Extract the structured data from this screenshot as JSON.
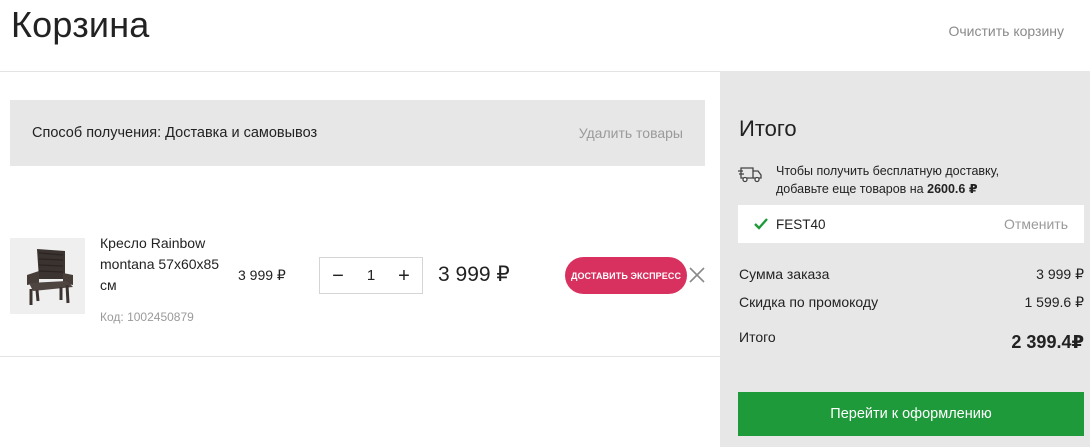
{
  "header": {
    "title": "Корзина",
    "clear_cart_label": "Очистить корзину"
  },
  "delivery": {
    "label": "Способ получения: Доставка и самовывоз",
    "remove_label": "Удалить товары"
  },
  "cart": {
    "items": [
      {
        "name": "Кресло Rainbow montana 57x60x85 см",
        "code": "Код: 1002450879",
        "unit_price": "3 999 ₽",
        "quantity": "1",
        "line_total": "3 999 ₽",
        "express_label": "ДОСТАВИТЬ ЭКСПРЕСС",
        "decrement_label": "−",
        "increment_label": "+"
      }
    ]
  },
  "summary": {
    "title": "Итого",
    "free_delivery_line1": "Чтобы получить бесплатную доставку,",
    "free_delivery_line2": "добавьте еще товаров на ",
    "free_delivery_amount": "2600.6 ₽",
    "promo_code": "FEST40",
    "promo_cancel": "Отменить",
    "order_sum_label": "Сумма заказа",
    "order_sum_value": "3 999 ₽",
    "discount_label": "Скидка по промокоду",
    "discount_value": "1 599.6 ₽",
    "total_label": "Итого",
    "total_value": "2 399.4₽",
    "checkout_label": "Перейти к оформлению"
  },
  "colors": {
    "accent_express": "#d8315f",
    "accent_checkout": "#1e9a3a",
    "panel_bg": "#e7e7e7",
    "check_green": "#1e9a3a"
  },
  "icons": {
    "truck": "truck-icon",
    "check": "check-icon",
    "close": "close-icon",
    "product": "chair-image"
  }
}
